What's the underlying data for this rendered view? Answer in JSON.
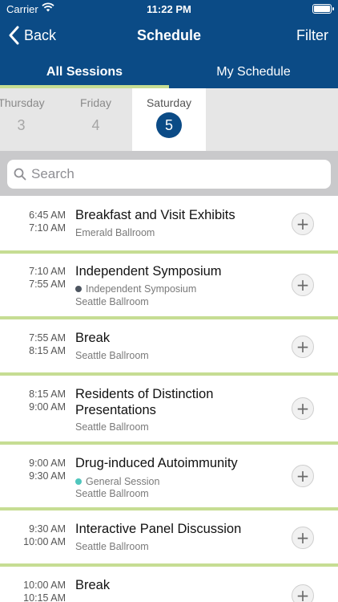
{
  "status": {
    "carrier": "Carrier",
    "time": "11:22 PM"
  },
  "nav": {
    "back_label": "Back",
    "title": "Schedule",
    "filter_label": "Filter"
  },
  "tabs": [
    {
      "label": "All Sessions"
    },
    {
      "label": "My Schedule"
    }
  ],
  "days": [
    {
      "name": "Thursday",
      "num": "3"
    },
    {
      "name": "Friday",
      "num": "4"
    },
    {
      "name": "Saturday",
      "num": "5"
    }
  ],
  "search": {
    "placeholder": "Search"
  },
  "sessions": [
    {
      "start": "6:45 AM",
      "end": "7:10 AM",
      "title": "Breakfast and Visit Exhibits",
      "track": "",
      "room": "Emerald Ballroom"
    },
    {
      "start": "7:10 AM",
      "end": "7:55 AM",
      "title": "Independent Symposium",
      "track": "Independent Symposium",
      "track_color": "#4d5560",
      "room": "Seattle Ballroom"
    },
    {
      "start": "7:55 AM",
      "end": "8:15 AM",
      "title": "Break",
      "track": "",
      "room": "Seattle Ballroom"
    },
    {
      "start": "8:15 AM",
      "end": "9:00 AM",
      "title": "Residents of Distinction Presentations",
      "track": "",
      "room": "Seattle Ballroom"
    },
    {
      "start": "9:00 AM",
      "end": "9:30 AM",
      "title": "Drug-induced Autoimmunity",
      "track": "General Session",
      "track_color": "#4fc6bd",
      "room": "Seattle Ballroom"
    },
    {
      "start": "9:30 AM",
      "end": "10:00 AM",
      "title": "Interactive Panel Discussion",
      "track": "",
      "room": "Seattle Ballroom"
    },
    {
      "start": "10:00 AM",
      "end": "10:15 AM",
      "title": "Break",
      "track": "",
      "room": ""
    }
  ],
  "add_symbol": "+",
  "colors": {
    "header": "#0b4b86",
    "accent": "#c6dd93"
  }
}
